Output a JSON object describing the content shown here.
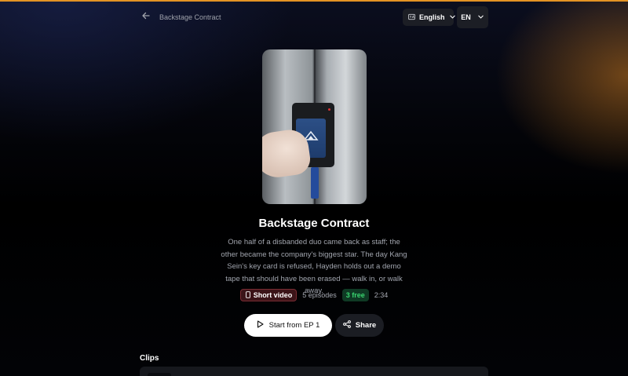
{
  "header": {
    "back_title": "Backstage Contract",
    "language_label": "English",
    "language_code": "EN"
  },
  "show": {
    "title": "Backstage Contract",
    "description": "One half of a disbanded duo came back as staff; the other became the company's biggest star. The day Kang Sein's key card is refused, Hayden holds out a demo tape that should have been erased — walk in, or walk away.",
    "format_badge": "Short video",
    "episodes": "5 episodes",
    "free_badge": "3 free",
    "duration": "2:34"
  },
  "actions": {
    "start_label": "Start from EP 1",
    "share_label": "Share"
  },
  "clips": {
    "heading": "Clips"
  },
  "colors": {
    "accent": "#e39324",
    "free_green": "#39d46f",
    "badge_red": "#7a2c33"
  },
  "icons": [
    "arrow-left-icon",
    "translate-icon",
    "chevron-down-icon",
    "phone-icon",
    "play-icon",
    "share-icon"
  ]
}
